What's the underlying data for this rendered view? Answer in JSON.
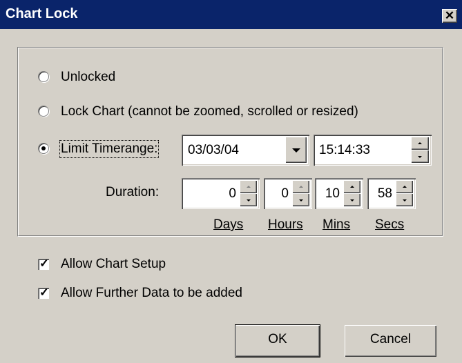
{
  "window": {
    "title": "Chart Lock",
    "close_glyph": "✕"
  },
  "lock_options": {
    "unlocked": {
      "label": "Unlocked",
      "checked": false
    },
    "lock_chart": {
      "label": "Lock Chart (cannot be zoomed, scrolled or resized)",
      "checked": false
    },
    "limit_timerange": {
      "label": "Limit Timerange:",
      "checked": true
    }
  },
  "timerange": {
    "date_value": "03/03/04",
    "time_value": "15:14:33"
  },
  "duration": {
    "label": "Duration:",
    "days": {
      "value": "0",
      "unit": "Days"
    },
    "hours": {
      "value": "0",
      "unit": "Hours"
    },
    "mins": {
      "value": "10",
      "unit": "Mins"
    },
    "secs": {
      "value": "58",
      "unit": "Secs"
    }
  },
  "options": {
    "allow_chart_setup": {
      "label": "Allow Chart Setup",
      "checked": true
    },
    "allow_further_data": {
      "label": "Allow Further Data to be added",
      "checked": true
    }
  },
  "buttons": {
    "ok": "OK",
    "cancel": "Cancel"
  },
  "colors": {
    "title_bar": "#0a246a",
    "dialog_bg": "#d4d0c8"
  },
  "icons": {
    "close": "close-icon",
    "dropdown": "chevron-down-icon",
    "check": "check-icon"
  }
}
